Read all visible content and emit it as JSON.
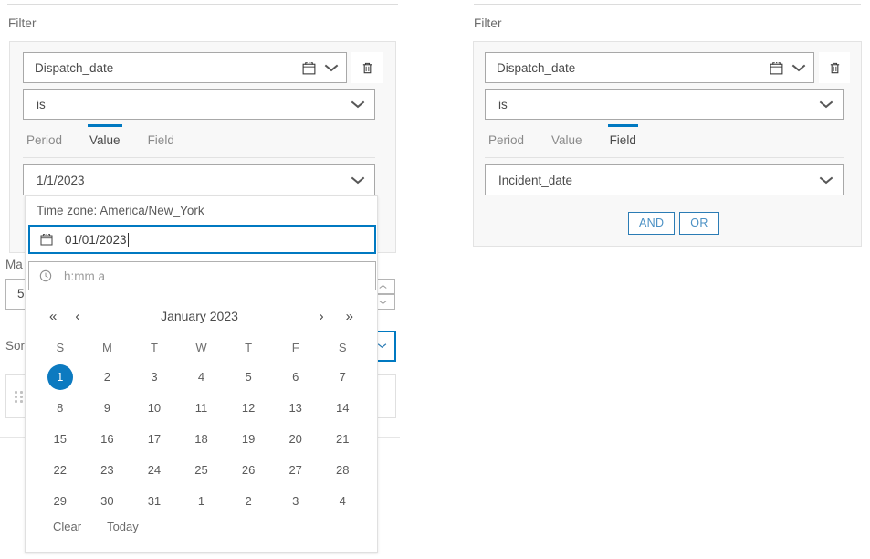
{
  "left_panel": {
    "section_label": "Filter",
    "filter": {
      "field_name": "Dispatch_date",
      "field_icon": "calendar-icon",
      "delete_icon": "trash-icon",
      "operator": "is",
      "tabs": [
        {
          "label": "Period",
          "active": false
        },
        {
          "label": "Value",
          "active": true
        },
        {
          "label": "Field",
          "active": false
        }
      ],
      "value": "1/1/2023"
    },
    "behind": {
      "max_label": "Ma",
      "max_value": "5",
      "sort_label": "Sor",
      "grip_icon": "drag-handle-icon"
    }
  },
  "date_picker": {
    "timezone_text": "Time zone: America/New_York",
    "date_input": {
      "icon": "calendar-icon",
      "value": "01/01/2023"
    },
    "time_input": {
      "icon": "clock-icon",
      "placeholder": "h:mm a",
      "value": ""
    },
    "nav": {
      "prev_year_icon": "chevron-double-left-icon",
      "prev_month_icon": "chevron-left-icon",
      "title": "January 2023",
      "next_month_icon": "chevron-right-icon",
      "next_year_icon": "chevron-double-right-icon",
      "prev_year_label": "«",
      "prev_month_label": "‹",
      "next_month_label": "›",
      "next_year_label": "»"
    },
    "day_headers": [
      "S",
      "M",
      "T",
      "W",
      "T",
      "F",
      "S"
    ],
    "weeks": [
      [
        {
          "n": "1",
          "selected": true
        },
        {
          "n": "2",
          "selected": false
        },
        {
          "n": "3",
          "selected": false
        },
        {
          "n": "4",
          "selected": false
        },
        {
          "n": "5",
          "selected": false
        },
        {
          "n": "6",
          "selected": false
        },
        {
          "n": "7",
          "selected": false
        }
      ],
      [
        {
          "n": "8",
          "selected": false
        },
        {
          "n": "9",
          "selected": false
        },
        {
          "n": "10",
          "selected": false
        },
        {
          "n": "11",
          "selected": false
        },
        {
          "n": "12",
          "selected": false
        },
        {
          "n": "13",
          "selected": false
        },
        {
          "n": "14",
          "selected": false
        }
      ],
      [
        {
          "n": "15",
          "selected": false
        },
        {
          "n": "16",
          "selected": false
        },
        {
          "n": "17",
          "selected": false
        },
        {
          "n": "18",
          "selected": false
        },
        {
          "n": "19",
          "selected": false
        },
        {
          "n": "20",
          "selected": false
        },
        {
          "n": "21",
          "selected": false
        }
      ],
      [
        {
          "n": "22",
          "selected": false
        },
        {
          "n": "23",
          "selected": false
        },
        {
          "n": "24",
          "selected": false
        },
        {
          "n": "25",
          "selected": false
        },
        {
          "n": "26",
          "selected": false
        },
        {
          "n": "27",
          "selected": false
        },
        {
          "n": "28",
          "selected": false
        }
      ],
      [
        {
          "n": "29",
          "selected": false
        },
        {
          "n": "30",
          "selected": false
        },
        {
          "n": "31",
          "selected": false
        },
        {
          "n": "1",
          "selected": false
        },
        {
          "n": "2",
          "selected": false
        },
        {
          "n": "3",
          "selected": false
        },
        {
          "n": "4",
          "selected": false
        }
      ]
    ],
    "footer": {
      "clear_label": "Clear",
      "today_label": "Today"
    }
  },
  "right_panel": {
    "section_label": "Filter",
    "filter": {
      "field_name": "Dispatch_date",
      "field_icon": "calendar-icon",
      "delete_icon": "trash-icon",
      "operator": "is",
      "tabs": [
        {
          "label": "Period",
          "active": false
        },
        {
          "label": "Value",
          "active": false
        },
        {
          "label": "Field",
          "active": true
        }
      ],
      "value": "Incident_date"
    },
    "logic_buttons": [
      {
        "label": "AND"
      },
      {
        "label": "OR"
      }
    ]
  },
  "colors": {
    "accent": "#0079c1",
    "selected_day": "#0c7ac0",
    "border": "#a8a8a8",
    "card_bg": "#f8f8f8",
    "text": "#4a4a4a",
    "muted": "#8a8a8a",
    "button_border": "#2b7cb5",
    "button_text": "#4a90c4"
  }
}
